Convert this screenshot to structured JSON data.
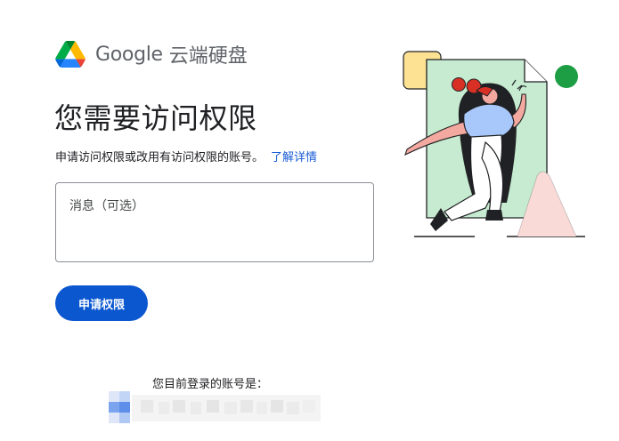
{
  "brand": {
    "logo_icon": "google-drive-icon",
    "google_word": "Google",
    "product_name": "云端硬盘"
  },
  "page": {
    "title": "您需要访问权限",
    "description": "申请访问权限或改用有访问权限的账号。",
    "learn_more_link": "了解详情"
  },
  "message_field": {
    "placeholder": "消息（可选）",
    "value": ""
  },
  "actions": {
    "request_button": "申请权限"
  },
  "account": {
    "signed_in_label": "您目前登录的账号是：",
    "email": "",
    "avatar_icon": "blurred-avatar-icon"
  },
  "illustration": {
    "icon": "person-stepping-out-of-document-icon"
  },
  "colors": {
    "primary_button": "#0b57d0",
    "link": "#1a5dd6",
    "illustration_green": "#c6ebd0",
    "illustration_yellow": "#fde293",
    "illustration_dot": "#1e9e44",
    "illustration_pink": "#f9dad7"
  }
}
